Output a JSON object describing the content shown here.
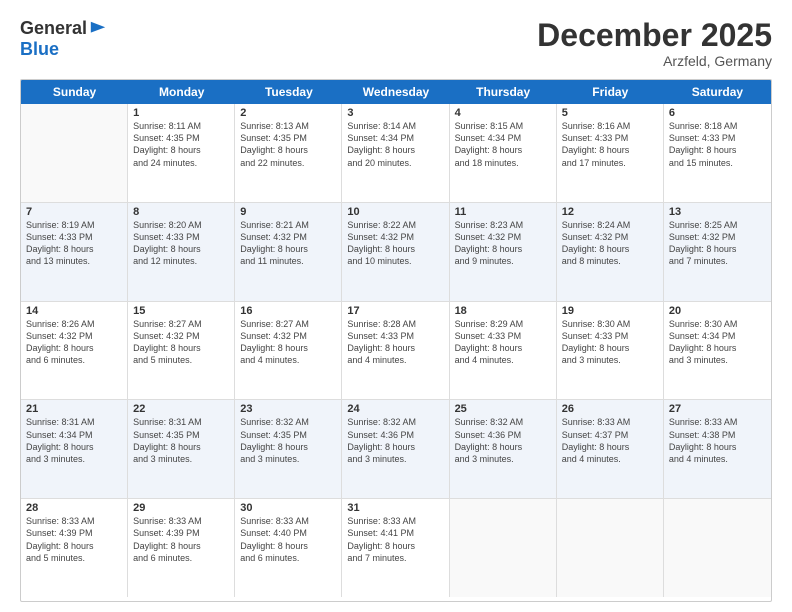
{
  "logo": {
    "general": "General",
    "blue": "Blue"
  },
  "title": "December 2025",
  "subtitle": "Arzfeld, Germany",
  "days": [
    "Sunday",
    "Monday",
    "Tuesday",
    "Wednesday",
    "Thursday",
    "Friday",
    "Saturday"
  ],
  "weeks": [
    [
      {
        "day": "",
        "info": ""
      },
      {
        "day": "1",
        "info": "Sunrise: 8:11 AM\nSunset: 4:35 PM\nDaylight: 8 hours\nand 24 minutes."
      },
      {
        "day": "2",
        "info": "Sunrise: 8:13 AM\nSunset: 4:35 PM\nDaylight: 8 hours\nand 22 minutes."
      },
      {
        "day": "3",
        "info": "Sunrise: 8:14 AM\nSunset: 4:34 PM\nDaylight: 8 hours\nand 20 minutes."
      },
      {
        "day": "4",
        "info": "Sunrise: 8:15 AM\nSunset: 4:34 PM\nDaylight: 8 hours\nand 18 minutes."
      },
      {
        "day": "5",
        "info": "Sunrise: 8:16 AM\nSunset: 4:33 PM\nDaylight: 8 hours\nand 17 minutes."
      },
      {
        "day": "6",
        "info": "Sunrise: 8:18 AM\nSunset: 4:33 PM\nDaylight: 8 hours\nand 15 minutes."
      }
    ],
    [
      {
        "day": "7",
        "info": "Sunrise: 8:19 AM\nSunset: 4:33 PM\nDaylight: 8 hours\nand 13 minutes."
      },
      {
        "day": "8",
        "info": "Sunrise: 8:20 AM\nSunset: 4:33 PM\nDaylight: 8 hours\nand 12 minutes."
      },
      {
        "day": "9",
        "info": "Sunrise: 8:21 AM\nSunset: 4:32 PM\nDaylight: 8 hours\nand 11 minutes."
      },
      {
        "day": "10",
        "info": "Sunrise: 8:22 AM\nSunset: 4:32 PM\nDaylight: 8 hours\nand 10 minutes."
      },
      {
        "day": "11",
        "info": "Sunrise: 8:23 AM\nSunset: 4:32 PM\nDaylight: 8 hours\nand 9 minutes."
      },
      {
        "day": "12",
        "info": "Sunrise: 8:24 AM\nSunset: 4:32 PM\nDaylight: 8 hours\nand 8 minutes."
      },
      {
        "day": "13",
        "info": "Sunrise: 8:25 AM\nSunset: 4:32 PM\nDaylight: 8 hours\nand 7 minutes."
      }
    ],
    [
      {
        "day": "14",
        "info": "Sunrise: 8:26 AM\nSunset: 4:32 PM\nDaylight: 8 hours\nand 6 minutes."
      },
      {
        "day": "15",
        "info": "Sunrise: 8:27 AM\nSunset: 4:32 PM\nDaylight: 8 hours\nand 5 minutes."
      },
      {
        "day": "16",
        "info": "Sunrise: 8:27 AM\nSunset: 4:32 PM\nDaylight: 8 hours\nand 4 minutes."
      },
      {
        "day": "17",
        "info": "Sunrise: 8:28 AM\nSunset: 4:33 PM\nDaylight: 8 hours\nand 4 minutes."
      },
      {
        "day": "18",
        "info": "Sunrise: 8:29 AM\nSunset: 4:33 PM\nDaylight: 8 hours\nand 4 minutes."
      },
      {
        "day": "19",
        "info": "Sunrise: 8:30 AM\nSunset: 4:33 PM\nDaylight: 8 hours\nand 3 minutes."
      },
      {
        "day": "20",
        "info": "Sunrise: 8:30 AM\nSunset: 4:34 PM\nDaylight: 8 hours\nand 3 minutes."
      }
    ],
    [
      {
        "day": "21",
        "info": "Sunrise: 8:31 AM\nSunset: 4:34 PM\nDaylight: 8 hours\nand 3 minutes."
      },
      {
        "day": "22",
        "info": "Sunrise: 8:31 AM\nSunset: 4:35 PM\nDaylight: 8 hours\nand 3 minutes."
      },
      {
        "day": "23",
        "info": "Sunrise: 8:32 AM\nSunset: 4:35 PM\nDaylight: 8 hours\nand 3 minutes."
      },
      {
        "day": "24",
        "info": "Sunrise: 8:32 AM\nSunset: 4:36 PM\nDaylight: 8 hours\nand 3 minutes."
      },
      {
        "day": "25",
        "info": "Sunrise: 8:32 AM\nSunset: 4:36 PM\nDaylight: 8 hours\nand 3 minutes."
      },
      {
        "day": "26",
        "info": "Sunrise: 8:33 AM\nSunset: 4:37 PM\nDaylight: 8 hours\nand 4 minutes."
      },
      {
        "day": "27",
        "info": "Sunrise: 8:33 AM\nSunset: 4:38 PM\nDaylight: 8 hours\nand 4 minutes."
      }
    ],
    [
      {
        "day": "28",
        "info": "Sunrise: 8:33 AM\nSunset: 4:39 PM\nDaylight: 8 hours\nand 5 minutes."
      },
      {
        "day": "29",
        "info": "Sunrise: 8:33 AM\nSunset: 4:39 PM\nDaylight: 8 hours\nand 6 minutes."
      },
      {
        "day": "30",
        "info": "Sunrise: 8:33 AM\nSunset: 4:40 PM\nDaylight: 8 hours\nand 6 minutes."
      },
      {
        "day": "31",
        "info": "Sunrise: 8:33 AM\nSunset: 4:41 PM\nDaylight: 8 hours\nand 7 minutes."
      },
      {
        "day": "",
        "info": ""
      },
      {
        "day": "",
        "info": ""
      },
      {
        "day": "",
        "info": ""
      }
    ]
  ]
}
